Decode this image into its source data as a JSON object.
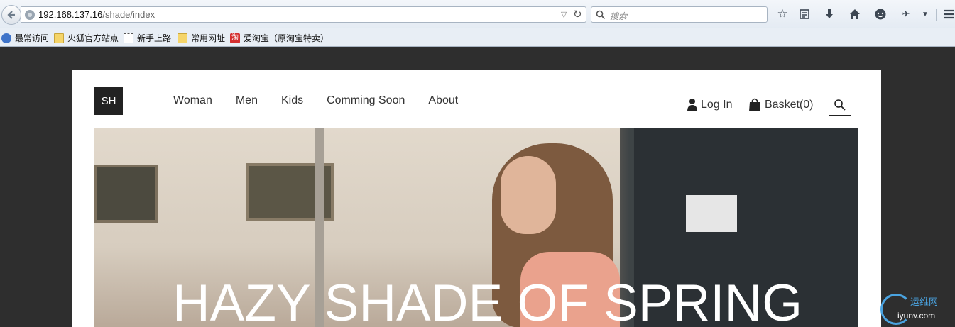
{
  "browser": {
    "url_host": "192.168.137.16",
    "url_path": "/shade/index",
    "search_placeholder": "搜索"
  },
  "bookmarks": [
    {
      "label": "最常访问",
      "icon": "globe-icon"
    },
    {
      "label": "火狐官方站点",
      "icon": "folder-icon"
    },
    {
      "label": "新手上路",
      "icon": "dotted-page-icon"
    },
    {
      "label": "常用网址",
      "icon": "folder-icon"
    },
    {
      "label": "爱淘宝（原淘宝特卖）",
      "icon": "taobao-icon",
      "icon_text": "淘"
    }
  ],
  "site": {
    "logo": "SH",
    "nav": [
      "Woman",
      "Men",
      "Kids",
      "Comming Soon",
      "About"
    ],
    "login_label": "Log In",
    "basket_label": "Basket(0)",
    "hero_title": "HAZY SHADE OF SPRING"
  },
  "watermark": {
    "cn": "运维网",
    "en": "iyunv.com"
  },
  "colors": {
    "page_bg": "#2e2e2e",
    "header_bg": "#ffffff",
    "logo_bg": "#222222",
    "watermark": "#4aa3e0"
  }
}
